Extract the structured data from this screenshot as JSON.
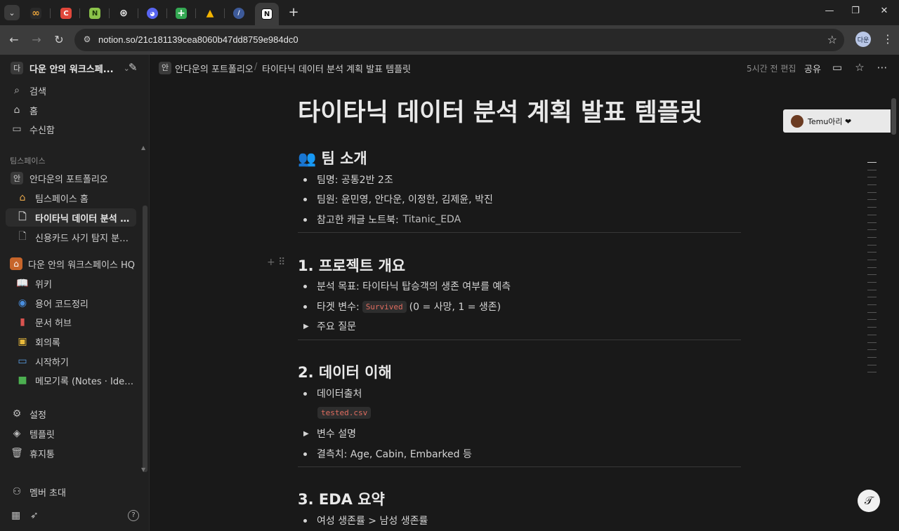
{
  "browser": {
    "url": "notion.so/21c181139cea8060b47dd8759e984dc0",
    "profile_initials": "다운",
    "tabs": [
      {
        "icon": "infinity-icon",
        "color": "#e8a33b",
        "glyph": "∞"
      },
      {
        "icon": "c-app-icon",
        "color": "#e0473b",
        "glyph": "C"
      },
      {
        "icon": "n-app-icon",
        "color": "#8bc34a",
        "glyph": "N"
      },
      {
        "icon": "openai-icon",
        "color": "#444444",
        "glyph": "◎"
      },
      {
        "icon": "discord-icon",
        "color": "#5865f2",
        "glyph": "●"
      },
      {
        "icon": "sheets-icon",
        "color": "#34a853",
        "glyph": "+"
      },
      {
        "icon": "drive-icon",
        "color": "#f4b400",
        "glyph": "▲"
      },
      {
        "icon": "feather-icon",
        "color": "#3d5a99",
        "glyph": "/"
      },
      {
        "icon": "notion-icon",
        "color": "#ffffff",
        "glyph": "N"
      }
    ]
  },
  "sidebar": {
    "workspace_name": "다운 안의 워크스페...",
    "workspace_badge": "다",
    "search": "검색",
    "home": "홈",
    "inbox": "수신함",
    "teamspace_header": "팀스페이스",
    "teamspace_badge": "안",
    "teamspace_name": "안다운의 포트폴리오",
    "items": [
      "팀스페이스 홈",
      "타이타닉 데이터 분석 계...",
      "신용카드 사기 탐지 분석 ..."
    ],
    "hq_name": "다운 안의 워크스페이스 HQ",
    "hq_items": [
      "위키",
      "용어 코드정리",
      "문서 허브",
      "회의록",
      "시작하기",
      "메모기록 (Notes · Ideas..."
    ],
    "settings": "설정",
    "templates": "템플릿",
    "trash": "휴지통",
    "invite": "멤버 초대"
  },
  "topbar": {
    "crumb_badge": "안",
    "crumb_parent": "안다운의 포트폴리오",
    "crumb_sep": "/",
    "crumb_current": "타이타닉 데이터 분석 계획 발표 템플릿",
    "edited": "5시간 전 편집",
    "share": "공유"
  },
  "page": {
    "title": "타이타닉 데이터 분석 계획 발표 템플릿",
    "s1": {
      "heading": "👥 팀 소개",
      "team_name": "팀명:  공통2반 2조",
      "members": "팀원: 윤민영, 안다운, 이정한, 김제윤, 박진",
      "notebook_label": "참고한 캐글 노트북:",
      "notebook_link": "Titanic_EDA"
    },
    "s2": {
      "heading": "1. 프로젝트 개요",
      "goal": "분석 목표: 타이타닉 탑승객의 생존 여부를 예측",
      "target_label": "타겟 변수:",
      "target_code": "Survived",
      "target_desc": "(0 = 사망, 1 = 생존)",
      "toggle": "주요 질문"
    },
    "s3": {
      "heading": "2. 데이터 이해",
      "source": "데이터출처",
      "source_code": "tested.csv",
      "toggle": "변수 설명",
      "missing": "결측치: Age, Cabin, Embarked 등"
    },
    "s4": {
      "heading": "3. EDA 요약",
      "first": "여성 생존률 > 남성 생존률"
    }
  },
  "comment": {
    "author": "Temu아리 ❤"
  }
}
